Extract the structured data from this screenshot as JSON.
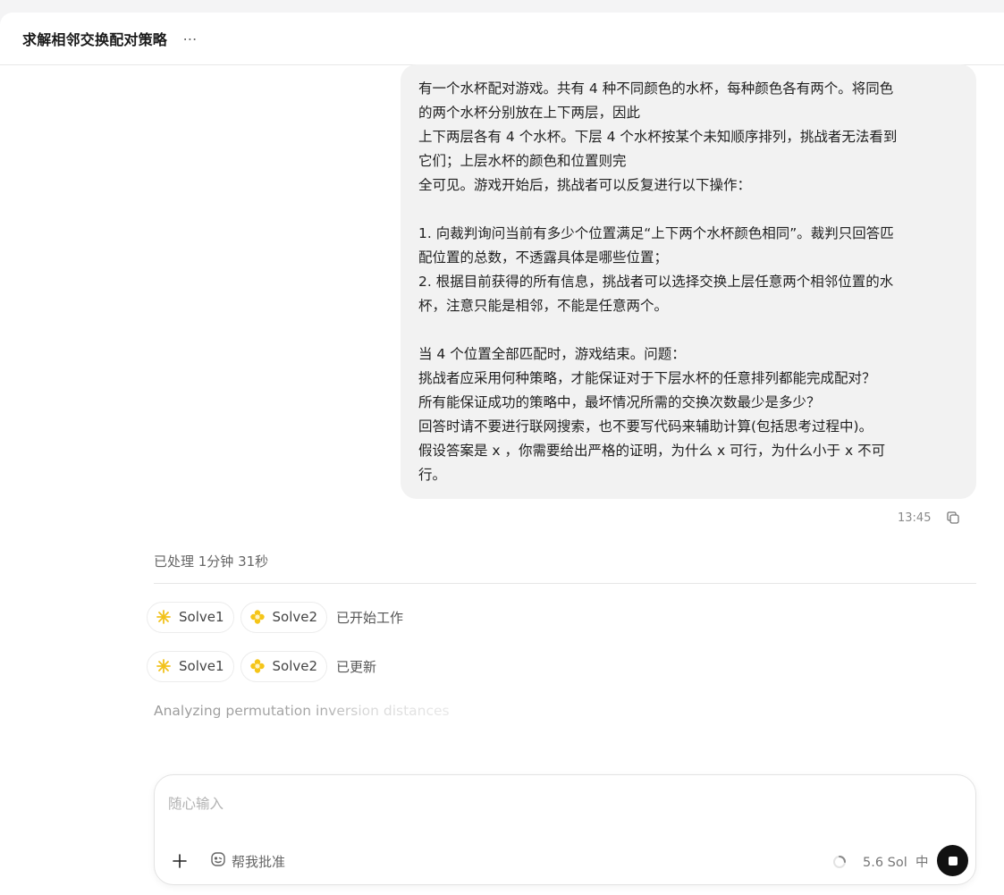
{
  "header": {
    "title": "求解相邻交换配对策略",
    "more_label": "⋯"
  },
  "message": {
    "text": "有一个水杯配对游戏。共有 4 种不同颜色的水杯，每种颜色各有两个。将同色\n的两个水杯分别放在上下两层，因此\n上下两层各有 4 个水杯。下层 4 个水杯按某个未知顺序排列，挑战者无法看到\n它们；上层水杯的颜色和位置则完\n全可见。游戏开始后，挑战者可以反复进行以下操作：\n\n1. 向裁判询问当前有多少个位置满足“上下两个水杯颜色相同”。裁判只回答匹\n配位置的总数，不透露具体是哪些位置；\n2. 根据目前获得的所有信息，挑战者可以选择交换上层任意两个相邻位置的水\n杯，注意只能是相邻，不能是任意两个。\n\n当 4 个位置全部匹配时，游戏结束。问题：\n挑战者应采用何种策略，才能保证对于下层水杯的任意排列都能完成配对？\n所有能保证成功的策略中，最坏情况所需的交换次数最少是多少？\n回答时请不要进行联网搜索，也不要写代码来辅助计算(包括思考过程中)。\n假设答案是 x ，你需要给出严格的证明，为什么 x 可行，为什么小于 x 不可\n行。",
    "time": "13:45"
  },
  "process": {
    "processed_label": "已处理 1分钟 31秒",
    "rows": [
      {
        "agents": [
          {
            "name": "Solve1",
            "icon": "sparkle-icon",
            "color": "#f5c518"
          },
          {
            "name": "Solve2",
            "icon": "flower-icon",
            "color": "#f5c518"
          }
        ],
        "status": "已开始工作"
      },
      {
        "agents": [
          {
            "name": "Solve1",
            "icon": "sparkle-icon",
            "color": "#f5c518"
          },
          {
            "name": "Solve2",
            "icon": "flower-icon",
            "color": "#f5c518"
          }
        ],
        "status": "已更新"
      }
    ],
    "thinking_text": "Analyzing permutation inversion distances"
  },
  "composer": {
    "placeholder": "随心输入",
    "approve_label": "帮我批准",
    "model_label": "5.6 Sol  中"
  }
}
